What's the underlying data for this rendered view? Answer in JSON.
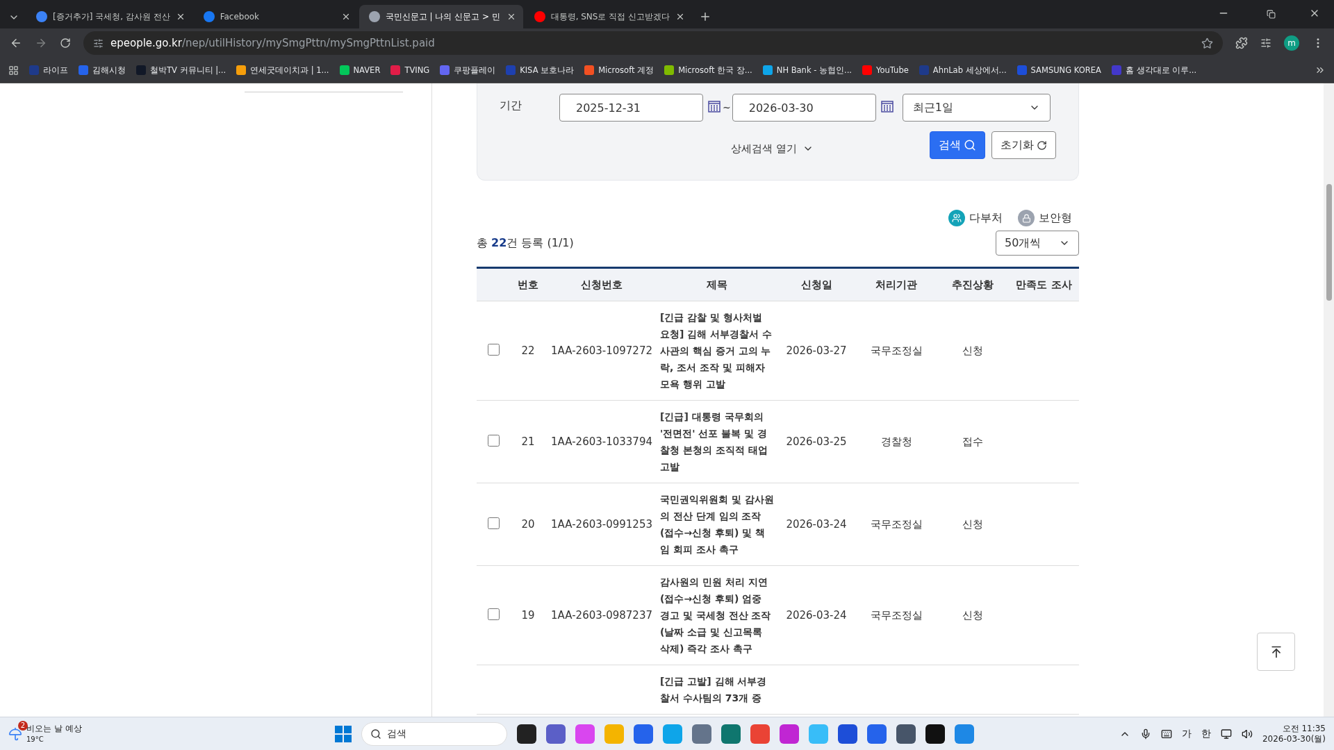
{
  "browser": {
    "tabs": [
      {
        "title": "[증거추가] 국세청, 감사원 전산",
        "selected": false,
        "color": "#3b82f6"
      },
      {
        "title": "Facebook",
        "selected": false,
        "color": "#1877f2"
      },
      {
        "title": "국민신문고 | 나의 신문고 > 민",
        "selected": true,
        "color": "#9ca3af"
      },
      {
        "title": "대통령, SNS로 직접 신고받겠다",
        "selected": false,
        "color": "#ff0000"
      }
    ],
    "url_host": "epeople.go.kr",
    "url_path": "/nep/utilHistory/mySmgPttn/mySmgPttnList.paid",
    "profile": "m",
    "bookmarks": [
      {
        "label": "라이프",
        "color": "#1e3a8a"
      },
      {
        "label": "김해시청",
        "color": "#2563eb"
      },
      {
        "label": "철박TV 커뮤니티 |...",
        "color": "#111827"
      },
      {
        "label": "연세굿데이치과 | 1...",
        "color": "#f59e0b"
      },
      {
        "label": "NAVER",
        "color": "#03c75a"
      },
      {
        "label": "TVING",
        "color": "#e11d48"
      },
      {
        "label": "쿠팡플레이",
        "color": "#6366f1"
      },
      {
        "label": "KISA 보호나라",
        "color": "#1e40af"
      },
      {
        "label": "Microsoft 계정",
        "color": "#f25022"
      },
      {
        "label": "Microsoft 한국 장...",
        "color": "#7fba00"
      },
      {
        "label": "NH Bank - 농협인...",
        "color": "#0ea5e9"
      },
      {
        "label": "YouTube",
        "color": "#ff0000"
      },
      {
        "label": "AhnLab  세상에서...",
        "color": "#1e3a8a"
      },
      {
        "label": "SAMSUNG KOREA",
        "color": "#1d4ed8"
      },
      {
        "label": "홈  생각대로 이루...",
        "color": "#4338ca"
      }
    ]
  },
  "filter": {
    "label": "기간",
    "date_from": "2025-12-31",
    "separator": "~",
    "date_to": "2026-03-30",
    "period": "최근1일",
    "detail_toggle": "상세검색 열기",
    "search_button": "검색",
    "reset_button": "초기화"
  },
  "legend": [
    {
      "label": "다부처",
      "color": "#14a3b8"
    },
    {
      "label": "보안형",
      "color": "#9ca3af"
    }
  ],
  "summary": "총 **22**건 등록 (1/1)",
  "page_size": "50개씩",
  "table": {
    "columns": [
      "번호",
      "신청번호",
      "제목",
      "신청일",
      "처리기관",
      "추진상황",
      "만족도 조사"
    ],
    "rows": [
      {
        "checked": false,
        "no": "22",
        "id": "1AA-2603-1097272",
        "title": "[긴급 감찰 및 형사처벌 요청] 김해 서부경찰서 수사관의 핵심 증거 고의 누락, 조서 조작 및 피해자 모욕 행위 고발",
        "date": "2026-03-27",
        "agency": "국무조정실",
        "status": "신청"
      },
      {
        "checked": false,
        "no": "21",
        "id": "1AA-2603-1033794",
        "title": "[긴급] 대통령 국무회의 '전면전' 선포 불복 및 경찰청 본청의 조직적 태업 고발",
        "date": "2026-03-25",
        "agency": "경찰청",
        "status": "접수"
      },
      {
        "checked": false,
        "no": "20",
        "id": "1AA-2603-0991253",
        "title": "국민권익위원회 및 감사원의 전산 단계 임의 조작(접수→신청 후퇴) 및 책임 회피 조사 촉구",
        "date": "2026-03-24",
        "agency": "국무조정실",
        "status": "신청"
      },
      {
        "checked": false,
        "no": "19",
        "id": "1AA-2603-0987237",
        "title": "감사원의 민원 처리 지연(접수→신청 후퇴) 엄중 경고 및 국세청 전산 조작(날짜 소급 및 신고목록 삭제) 즉각 조사 촉구",
        "date": "2026-03-24",
        "agency": "국무조정실",
        "status": "신청"
      },
      {
        "title": "[긴급 고발] 김해 서부경찰서 수사팀의 73개 증"
      }
    ]
  },
  "taskbar": {
    "weather": "비오는 날 예상",
    "temperature": "19°C",
    "badge": "2",
    "search": "검색",
    "ime_1": "가",
    "ime_2": "한",
    "time": "오전 11:35",
    "date": "2026-03-30(월)"
  }
}
